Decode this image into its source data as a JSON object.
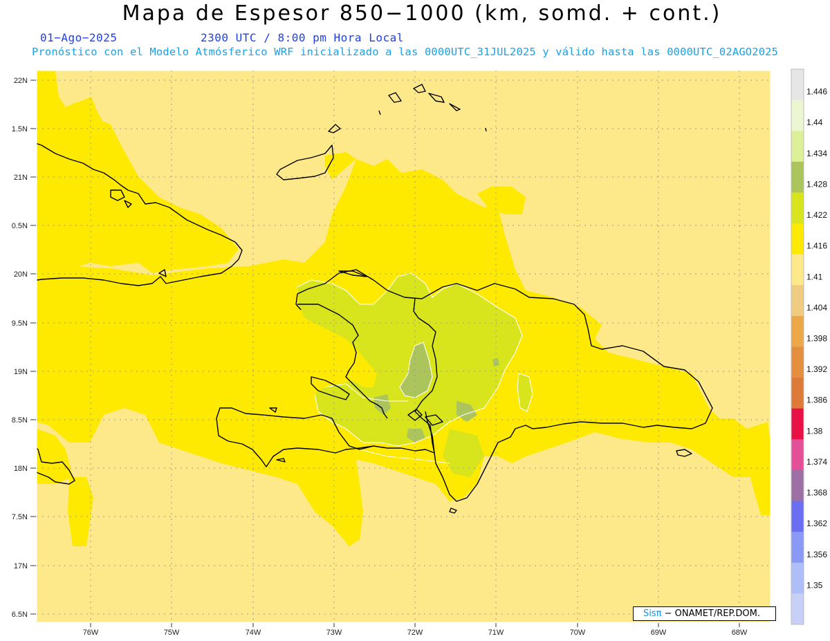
{
  "header": {
    "title": "Mapa de Espesor 850−1000 (km, somd. + cont.)",
    "date": "01−Ago−2025",
    "time": "2300 UTC / 8:00 pm Hora Local",
    "description": "Pronóstico con el Modelo Atmósferico WRF inicializado a las 0000UTC_31JUL2025 y válido hasta las  0000UTC_02AGO2025"
  },
  "credit": {
    "brand": "Sisπ",
    "org": " − ONAMET/REP.DOM."
  },
  "map": {
    "lat_labels": [
      "22N",
      "1.5N",
      "21N",
      "0.5N",
      "20N",
      "9.5N",
      "19N",
      "8.5N",
      "18N",
      "7.5N",
      "17N",
      "6.5N"
    ],
    "lon_labels": [
      "76W",
      "75W",
      "74W",
      "73W",
      "72W",
      "71W",
      "70W",
      "69W",
      "68W"
    ],
    "colors": {
      "background_field": "#fee98a",
      "yellow": "#fee900",
      "light_green": "#d8e51d",
      "green": "#acc45c"
    }
  },
  "colorbar": {
    "labels": [
      "1.446",
      "1.44",
      "1.434",
      "1.428",
      "1.422",
      "1.416",
      "1.41",
      "1.404",
      "1.398",
      "1.392",
      "1.386",
      "1.38",
      "1.374",
      "1.368",
      "1.362",
      "1.356",
      "1.35"
    ],
    "colors": [
      "#e6e6e6",
      "#ecf6d0",
      "#dcf09a",
      "#acc45c",
      "#d8e51d",
      "#fee900",
      "#fee98a",
      "#f0cc80",
      "#eca748",
      "#e48f40",
      "#de7a38",
      "#e81044",
      "#e45098",
      "#9c70a4",
      "#6a6ef0",
      "#8a98f6",
      "#aebef8",
      "#c8d0f8"
    ]
  }
}
